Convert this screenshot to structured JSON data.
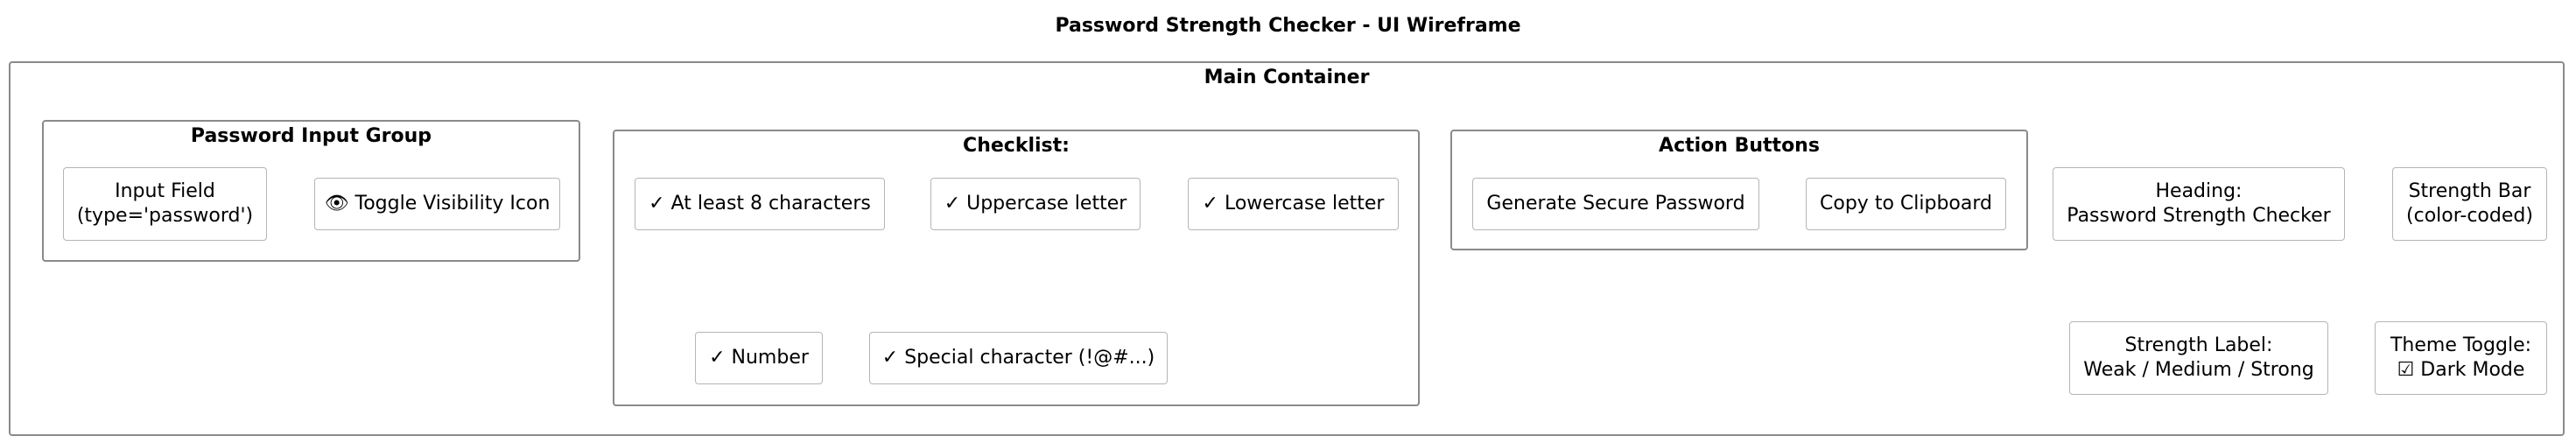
{
  "diagram": {
    "title": "Password Strength Checker - UI Wireframe",
    "main_container": {
      "label": "Main Container",
      "password_input_group": {
        "label": "Password Input Group",
        "input_field": "Input Field\n(type='password')",
        "toggle_visibility": "👁 Toggle Visibility Icon"
      },
      "checklist": {
        "label": "Checklist:",
        "items": [
          "✓ At least 8 characters",
          "✓ Uppercase letter",
          "✓ Lowercase letter",
          "✓ Number",
          "✓ Special character (!@#...)"
        ]
      },
      "action_buttons": {
        "label": "Action Buttons",
        "generate": "Generate Secure Password",
        "copy": "Copy to Clipboard"
      },
      "heading": "Heading:\nPassword Strength Checker",
      "strength_bar": "Strength Bar\n(color-coded)",
      "strength_label": "Strength Label:\nWeak / Medium / Strong",
      "theme_toggle": "Theme Toggle:\n☑ Dark Mode"
    }
  }
}
